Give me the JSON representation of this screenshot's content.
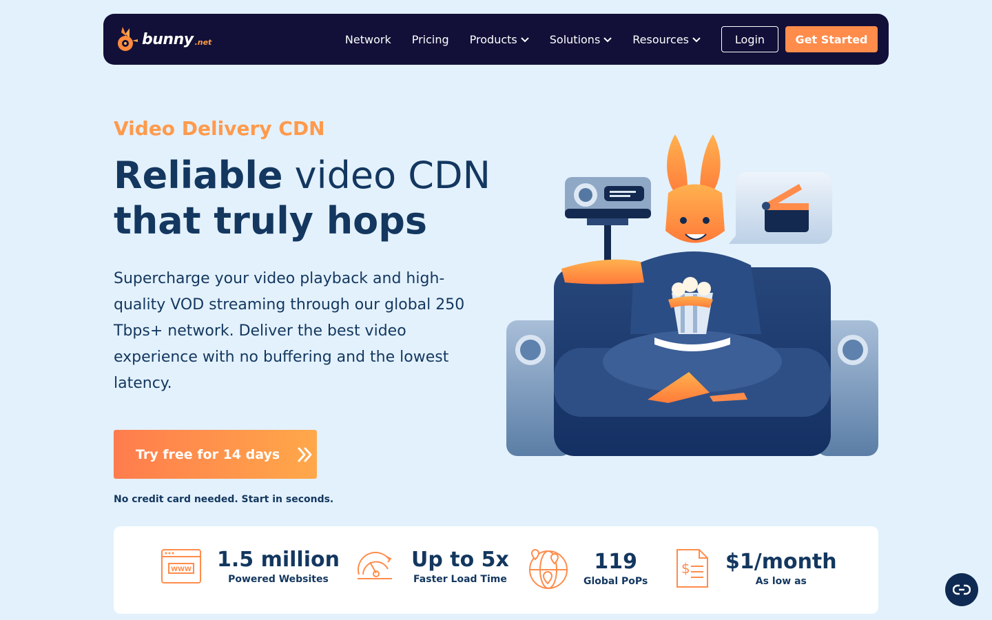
{
  "nav": {
    "logo_word": "bunny",
    "logo_tld": ".net",
    "links": [
      {
        "label": "Network"
      },
      {
        "label": "Pricing"
      },
      {
        "label": "Products"
      },
      {
        "label": "Solutions"
      },
      {
        "label": "Resources"
      }
    ],
    "login": "Login",
    "get_started": "Get Started"
  },
  "hero": {
    "eyebrow": "Video Delivery CDN",
    "headline_bold": "Reliable",
    "headline_rest": " video CDN",
    "headline_line2": "that truly hops",
    "description": "Supercharge your video playback and high-quality VOD streaming through our global 250 Tbps+ network. Deliver the best video experience with no buffering and the lowest latency.",
    "cta": "Try free for 14 days",
    "note": "No credit card needed. Start in seconds."
  },
  "stats": [
    {
      "value": "1.5 million",
      "label": "Powered Websites",
      "icon": "www-browser-icon"
    },
    {
      "value": "Up to 5x",
      "label": "Faster Load Time",
      "icon": "speedometer-icon"
    },
    {
      "value": "119",
      "label": "Global PoPs",
      "icon": "globe-pins-icon"
    },
    {
      "value": "$1/month",
      "label": "As low as",
      "icon": "invoice-dollar-icon"
    }
  ],
  "colors": {
    "accent": "#ff8c4b",
    "navy": "#121038",
    "text": "#13375f",
    "background": "#e3f1fc"
  }
}
